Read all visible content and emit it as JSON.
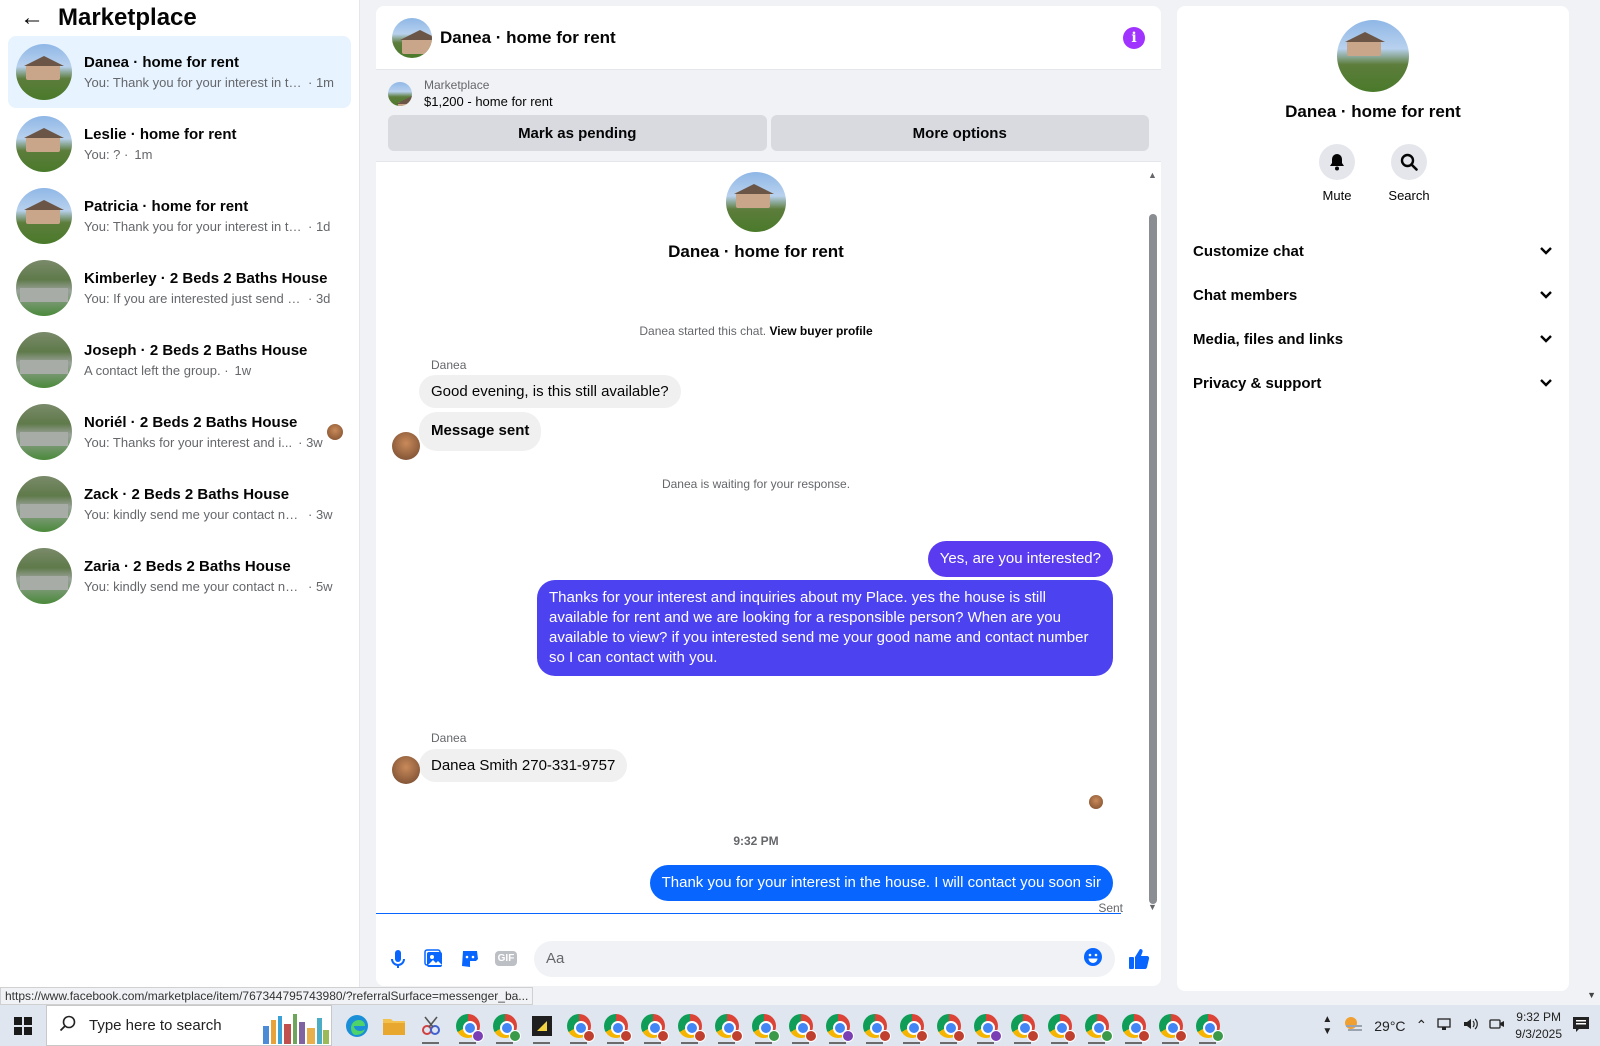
{
  "sidebar": {
    "title": "Marketplace",
    "conversations": [
      {
        "title": "Danea · home for rent",
        "snippet": "You: Thank you for your interest in th...",
        "time": "· 1m",
        "thumb": "house",
        "active": true
      },
      {
        "title": "Leslie · home for rent",
        "snippet": "You: ? ·",
        "time": "1m",
        "thumb": "house"
      },
      {
        "title": "Patricia · home for rent",
        "snippet": "You: Thank you for your interest in th...",
        "time": "· 1d",
        "thumb": "house"
      },
      {
        "title": "Kimberley · 2 Beds 2 Baths House",
        "snippet": "You: If you are interested just send us ...",
        "time": "· 3d",
        "thumb": "patio"
      },
      {
        "title": "Joseph · 2 Beds 2 Baths House",
        "snippet": "A contact left the group. ·",
        "time": "1w",
        "thumb": "patio"
      },
      {
        "title": "Noriél · 2 Beds 2 Baths House",
        "snippet": "You: Thanks for your interest and i...",
        "time": "· 3w",
        "thumb": "patio",
        "seen_avatar": true
      },
      {
        "title": "Zack · 2 Beds 2 Baths House",
        "snippet": "You: kindly send me your contact nu...",
        "time": "· 3w",
        "thumb": "patio"
      },
      {
        "title": "Zaria · 2 Beds 2 Baths House",
        "snippet": "You: kindly send me your contact nu...",
        "time": "· 5w",
        "thumb": "patio"
      }
    ]
  },
  "chat": {
    "title": "Danea · home for rent",
    "listing": {
      "source": "Marketplace",
      "price_title": "$1,200 - home for rent",
      "mark_pending": "Mark as pending",
      "more_options": "More options"
    },
    "intro_name": "Danea · home for rent",
    "started_text": "Danea started this chat.",
    "view_profile": "View buyer profile",
    "sender_name": "Danea",
    "msg_in_1": "Good evening, is this still available?",
    "msg_in_2": "Message sent",
    "waiting_text": "Danea is waiting for your response.",
    "msg_out_1": "Yes, are you interested?",
    "msg_out_2": "Thanks for your interest and inquiries about my Place. yes the house is still available for rent and we are looking for a responsible person? When are you available to view? if you interested send me your good name and contact number so I can contact with you.",
    "sender_name_2": "Danea",
    "msg_in_3": "Danea Smith 270-331-9757",
    "timestamp": "9:32 PM",
    "msg_out_3": "Thank you for your interest in the house. I will contact you soon sir",
    "sent_status": "Sent",
    "composer_placeholder": "Aa",
    "gif_label": "GIF"
  },
  "info_panel": {
    "name": "Danea · home for rent",
    "mute_label": "Mute",
    "search_label": "Search",
    "sections": [
      "Customize chat",
      "Chat members",
      "Media, files and links",
      "Privacy & support"
    ]
  },
  "status_url": "https://www.facebook.com/marketplace/item/767344795743980/?referralSurface=messenger_ba...",
  "taskbar": {
    "search_placeholder": "Type here to search",
    "temperature": "29°C",
    "time": "9:32 PM",
    "date": "9/3/2025"
  },
  "colors": {
    "accent_purple": "#a033ff",
    "bubble_out_violet": "#5b3bf0",
    "bubble_out_blue": "#0866ff",
    "active_row": "#e7f3ff"
  }
}
